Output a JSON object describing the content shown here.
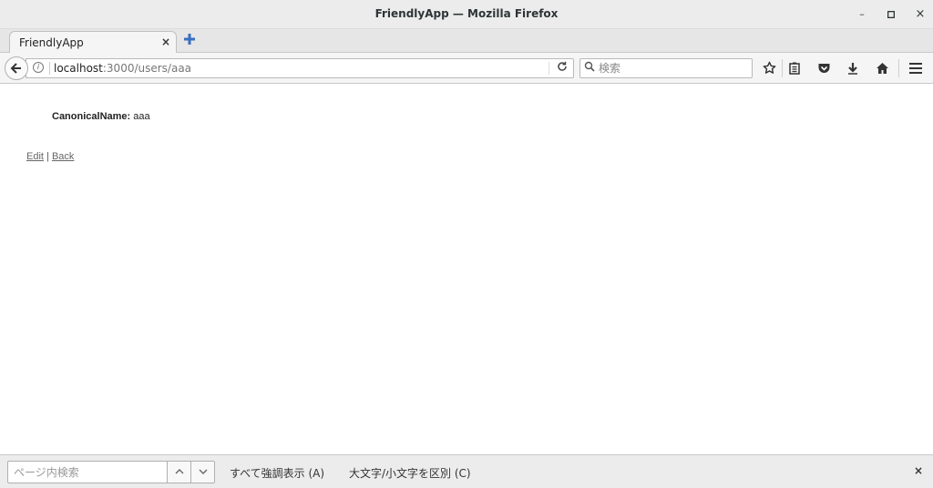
{
  "window": {
    "title": "FriendlyApp — Mozilla Firefox",
    "minimize": "–",
    "maximize": "□",
    "close": "×"
  },
  "tabs": [
    {
      "label": "FriendlyApp",
      "close": "×"
    }
  ],
  "navbar": {
    "url_host": "localhost",
    "url_rest": ":3000/users/aaa",
    "search_placeholder": "検索"
  },
  "page": {
    "field_label": "CanonicalName:",
    "field_value": "aaa",
    "edit_link": "Edit",
    "separator": "|",
    "back_link": "Back"
  },
  "findbar": {
    "placeholder": "ページ内検索",
    "highlight_all": "すべて強調表示 (A)",
    "match_case": "大文字/小文字を区別 (C)",
    "close": "×"
  }
}
